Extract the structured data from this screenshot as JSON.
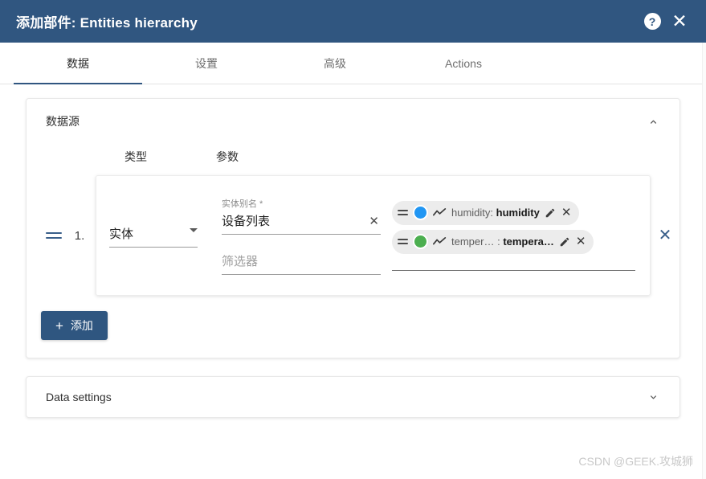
{
  "header": {
    "title": "添加部件: Entities hierarchy",
    "help_icon": "help-icon",
    "help_glyph": "?",
    "close_glyph": "✕",
    "background": "#305680"
  },
  "tabs": [
    {
      "label": "数据",
      "active": true
    },
    {
      "label": "设置",
      "active": false
    },
    {
      "label": "高级",
      "active": false
    },
    {
      "label": "Actions",
      "active": false
    }
  ],
  "datasource_panel": {
    "title": "数据源",
    "collapse_icon": "chevron-up-icon",
    "columns": {
      "type": "类型",
      "params": "参数"
    },
    "row": {
      "index": "1.",
      "drag_handle": "drag-handle-icon",
      "type_value": "实体",
      "alias_label": "实体别名 *",
      "alias_value": "设备列表",
      "alias_clear_glyph": "✕",
      "filter_placeholder": "筛选器",
      "delete_glyph": "✕",
      "chips": [
        {
          "color": "#2196f3",
          "icon": "line-chart-icon",
          "name": "humidity:",
          "label": "humidity",
          "edit_icon": "pencil-icon",
          "remove_glyph": "✕"
        },
        {
          "color": "#4caf50",
          "icon": "line-chart-icon",
          "name": "temper… :",
          "label": "tempera…",
          "edit_icon": "pencil-icon",
          "remove_glyph": "✕"
        }
      ]
    },
    "add_button": {
      "label": "添加",
      "plus": "+"
    }
  },
  "data_settings": {
    "label": "Data settings",
    "expand_icon": "chevron-down-icon"
  },
  "watermark": "CSDN @GEEK.攻城狮"
}
